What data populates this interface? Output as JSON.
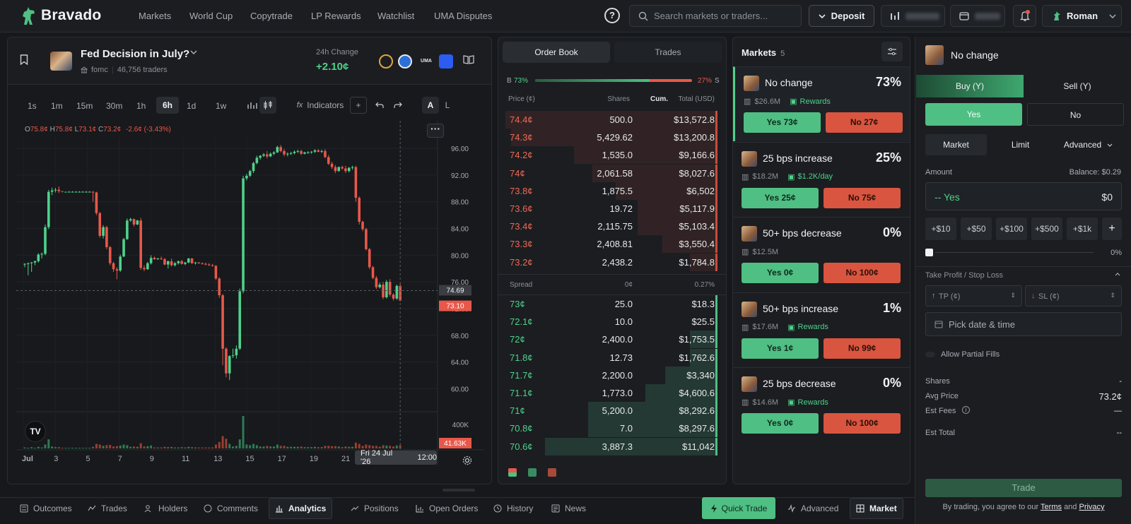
{
  "brand": {
    "name": "Bravado"
  },
  "nav": {
    "links": [
      "Markets",
      "World Cup",
      "Copytrade",
      "LP Rewards",
      "Watchlist",
      "UMA Disputes"
    ],
    "help": "?",
    "search_placeholder": "Search markets or traders...",
    "deposit": "Deposit",
    "user": "Roman"
  },
  "market": {
    "title": "Fed Decision in July?",
    "tag": "fomc",
    "traders": "46,756 traders",
    "change_label": "24h Change",
    "change_value": "+2.10¢"
  },
  "chart_toolbar": {
    "timeframes": [
      "1s",
      "1m",
      "15m",
      "30m",
      "1h",
      "6h",
      "1d",
      "1w"
    ],
    "selected": "6h",
    "indicators": "Indicators",
    "scale_a": "A",
    "scale_l": "L"
  },
  "chart_data": {
    "type": "candlestick",
    "ohlc_readout": {
      "o_label": "O",
      "o": "75.8¢",
      "h_label": "H",
      "h": "75.8¢",
      "l_label": "L",
      "l": "73.1¢",
      "c_label": "C",
      "c": "73.2¢",
      "chg": "-2.6¢ (-3.43%)"
    },
    "y_ticks": [
      "96.00",
      "92.00",
      "88.00",
      "84.00",
      "80.00",
      "76.00",
      "72.00",
      "68.00",
      "64.00",
      "60.00"
    ],
    "ylim": [
      57.4,
      97.6
    ],
    "volume_tick": "400K",
    "x_ticks": [
      "Jul",
      "3",
      "5",
      "7",
      "9",
      "11",
      "13",
      "15",
      "17",
      "19",
      "21"
    ],
    "crosshair_price": "74.69",
    "last_price": "73.10",
    "last_volume": "41.63K",
    "crosshair_date": "Fri 24 Jul '26",
    "crosshair_time": "12:00",
    "tv_logo": "TV",
    "candles": [
      [
        78.6,
        78.8,
        78.2,
        78.7
      ],
      [
        78.7,
        78.9,
        77.0,
        78.8
      ],
      [
        78.8,
        79.0,
        77.5,
        78.9
      ],
      [
        78.9,
        79.2,
        78.5,
        79.1
      ],
      [
        79.1,
        80.3,
        78.9,
        80.1
      ],
      [
        80.1,
        80.4,
        79.5,
        80.2
      ],
      [
        80.2,
        84.6,
        80.0,
        84.2
      ],
      [
        84.2,
        89.8,
        83.9,
        89.5
      ],
      [
        89.5,
        90.1,
        89.0,
        89.7
      ],
      [
        89.7,
        90.1,
        89.4,
        89.8
      ],
      [
        89.8,
        90.3,
        89.3,
        89.6
      ],
      [
        89.6,
        89.6,
        89.4,
        89.5
      ],
      [
        89.5,
        89.5,
        89.4,
        89.5
      ],
      [
        89.5,
        89.6,
        89.4,
        89.5
      ],
      [
        89.5,
        89.6,
        89.4,
        89.5
      ],
      [
        89.5,
        89.6,
        89.4,
        89.5
      ],
      [
        89.5,
        89.6,
        89.4,
        89.5
      ],
      [
        89.5,
        89.6,
        89.4,
        89.5
      ],
      [
        89.5,
        89.6,
        89.4,
        89.5
      ],
      [
        89.5,
        89.6,
        89.4,
        89.5
      ],
      [
        89.5,
        89.6,
        88.0,
        89.4
      ],
      [
        89.4,
        89.5,
        86.0,
        86.3
      ],
      [
        86.3,
        86.5,
        82.6,
        82.9
      ],
      [
        82.9,
        84.5,
        82.5,
        84.2
      ],
      [
        84.2,
        84.4,
        80.9,
        81.2
      ],
      [
        81.2,
        81.4,
        78.5,
        78.8
      ],
      [
        78.8,
        79.0,
        77.5,
        77.9
      ],
      [
        77.9,
        78.2,
        76.4,
        77.7
      ],
      [
        77.7,
        80.1,
        77.5,
        79.8
      ],
      [
        79.8,
        82.6,
        79.7,
        82.4
      ],
      [
        82.4,
        85.5,
        82.3,
        85.2
      ],
      [
        85.2,
        85.6,
        85.0,
        85.4
      ],
      [
        85.4,
        85.5,
        84.3,
        84.6
      ],
      [
        84.6,
        85.3,
        84.5,
        85.2
      ],
      [
        85.2,
        85.6,
        77.8,
        78.1
      ],
      [
        78.1,
        78.5,
        77.6,
        77.9
      ],
      [
        77.9,
        79.0,
        77.8,
        78.8
      ],
      [
        78.8,
        80.0,
        78.6,
        79.6
      ],
      [
        79.6,
        79.8,
        79.3,
        79.4
      ],
      [
        79.4,
        79.6,
        79.3,
        79.5
      ],
      [
        79.5,
        79.8,
        79.3,
        79.4
      ],
      [
        79.4,
        79.6,
        78.5,
        78.6
      ],
      [
        78.6,
        79.2,
        78.0,
        79.1
      ],
      [
        79.1,
        79.5,
        78.3,
        78.5
      ],
      [
        78.5,
        79.0,
        78.3,
        78.8
      ],
      [
        78.8,
        79.2,
        78.6,
        79.1
      ],
      [
        79.1,
        79.3,
        78.6,
        78.7
      ],
      [
        78.7,
        79.0,
        78.5,
        78.9
      ],
      [
        78.9,
        79.6,
        78.8,
        79.5
      ],
      [
        79.5,
        79.6,
        78.7,
        78.8
      ],
      [
        78.8,
        79.0,
        78.6,
        78.9
      ],
      [
        78.9,
        79.0,
        78.7,
        78.8
      ],
      [
        78.8,
        78.9,
        78.6,
        78.7
      ],
      [
        78.7,
        78.9,
        78.5,
        78.6
      ],
      [
        78.6,
        78.8,
        78.4,
        78.5
      ],
      [
        78.5,
        78.7,
        78.3,
        78.4
      ],
      [
        78.4,
        78.5,
        76.3,
        76.5
      ],
      [
        76.5,
        76.7,
        73.6,
        74.0
      ],
      [
        74.0,
        74.2,
        63.5,
        66.0
      ],
      [
        66.0,
        66.2,
        61.7,
        62.3
      ],
      [
        62.3,
        65.0,
        61.3,
        64.9
      ],
      [
        64.9,
        66.0,
        64.6,
        65.0
      ],
      [
        65.0,
        66.5,
        64.5,
        66.0
      ],
      [
        66.0,
        75.0,
        65.8,
        74.6
      ],
      [
        74.6,
        91.9,
        74.3,
        91.5
      ],
      [
        91.5,
        92.2,
        91.2,
        91.9
      ],
      [
        91.9,
        92.8,
        91.7,
        92.6
      ],
      [
        92.6,
        94.0,
        92.3,
        93.8
      ],
      [
        93.8,
        94.9,
        93.6,
        94.6
      ],
      [
        94.6,
        95.0,
        94.3,
        94.9
      ],
      [
        94.9,
        95.3,
        94.7,
        95.1
      ],
      [
        95.1,
        95.6,
        94.5,
        94.8
      ],
      [
        94.8,
        95.4,
        94.7,
        95.2
      ],
      [
        95.2,
        95.6,
        95.0,
        95.4
      ],
      [
        95.4,
        96.4,
        95.3,
        96.2
      ],
      [
        96.2,
        96.5,
        95.4,
        95.6
      ],
      [
        95.6,
        95.9,
        94.8,
        95.1
      ],
      [
        95.1,
        95.4,
        94.8,
        95.2
      ],
      [
        95.2,
        95.5,
        95.0,
        95.3
      ],
      [
        95.3,
        95.7,
        95.1,
        95.5
      ],
      [
        95.5,
        95.8,
        95.3,
        95.6
      ],
      [
        95.6,
        95.8,
        95.0,
        95.2
      ],
      [
        95.2,
        95.5,
        95.1,
        95.4
      ],
      [
        95.4,
        95.6,
        95.2,
        95.4
      ],
      [
        95.4,
        95.6,
        95.2,
        95.5
      ],
      [
        95.5,
        95.9,
        95.3,
        95.7
      ],
      [
        95.7,
        95.9,
        95.4,
        95.5
      ],
      [
        95.5,
        95.8,
        95.3,
        95.6
      ],
      [
        95.6,
        95.9,
        94.5,
        94.7
      ],
      [
        94.7,
        95.0,
        93.5,
        93.7
      ],
      [
        93.7,
        94.0,
        92.9,
        93.2
      ],
      [
        93.2,
        93.5,
        92.3,
        92.6
      ],
      [
        92.6,
        93.3,
        92.5,
        93.2
      ],
      [
        93.2,
        93.4,
        92.8,
        93.0
      ],
      [
        93.0,
        93.4,
        92.3,
        92.6
      ],
      [
        92.6,
        93.2,
        92.4,
        93.1
      ],
      [
        93.1,
        93.4,
        92.8,
        93.2
      ],
      [
        93.2,
        93.4,
        88.0,
        88.6
      ],
      [
        88.6,
        88.8,
        84.6,
        85.0
      ],
      [
        85.0,
        85.2,
        83.6,
        83.9
      ],
      [
        83.9,
        84.1,
        80.7,
        80.9
      ],
      [
        80.9,
        81.1,
        77.9,
        78.2
      ],
      [
        78.2,
        78.4,
        76.4,
        76.6
      ],
      [
        76.6,
        76.9,
        74.9,
        75.2
      ],
      [
        75.2,
        75.9,
        75.0,
        75.6
      ],
      [
        75.6,
        76.0,
        73.4,
        73.7
      ],
      [
        73.7,
        76.3,
        73.5,
        76.0
      ],
      [
        76.0,
        76.4,
        73.8,
        74.1
      ],
      [
        74.1,
        74.3,
        73.2,
        73.5
      ],
      [
        73.5,
        75.6,
        73.3,
        75.4
      ],
      [
        75.4,
        75.8,
        73.1,
        73.2
      ]
    ],
    "volumes": [
      3,
      2,
      4,
      2,
      5,
      3,
      12,
      28,
      6,
      4,
      4,
      2,
      2,
      2,
      2,
      2,
      2,
      2,
      2,
      2,
      5,
      14,
      12,
      8,
      10,
      11,
      6,
      7,
      9,
      12,
      10,
      5,
      6,
      5,
      16,
      6,
      7,
      9,
      3,
      3,
      3,
      5,
      4,
      5,
      3,
      3,
      4,
      3,
      5,
      4,
      3,
      3,
      3,
      3,
      3,
      3,
      12,
      20,
      38,
      30,
      14,
      6,
      8,
      28,
      100,
      12,
      10,
      14,
      10,
      6,
      6,
      8,
      6,
      6,
      12,
      8,
      8,
      5,
      5,
      5,
      5,
      6,
      4,
      4,
      4,
      5,
      4,
      4,
      8,
      8,
      7,
      7,
      6,
      4,
      6,
      5,
      5,
      18,
      14,
      8,
      12,
      10,
      8,
      8,
      5,
      10,
      9,
      8,
      6,
      9,
      10
    ]
  },
  "orderbook": {
    "tabs": [
      "Order Book",
      "Trades"
    ],
    "active_tab": "Order Book",
    "b_label": "B",
    "b_pct": "73%",
    "s_pct": "27%",
    "s_label": "S",
    "col_price": "Price (¢)",
    "col_shares": "Shares",
    "col_cum": "Cum.",
    "col_total": "Total (USD)",
    "asks": [
      {
        "price": "74.4¢",
        "shares": "500.0",
        "total": "$13,572.8",
        "depth": 0.0
      },
      {
        "price": "74.3¢",
        "shares": "5,429.62",
        "total": "$13,200.8",
        "depth": 0.0
      },
      {
        "price": "74.2¢",
        "shares": "1,535.0",
        "total": "$9,166.6",
        "depth": 0.0
      },
      {
        "price": "74¢",
        "shares": "2,061.58",
        "total": "$8,027.6",
        "depth": 0.0
      },
      {
        "price": "73.8¢",
        "shares": "1,875.5",
        "total": "$6,502",
        "depth": 0.0
      },
      {
        "price": "73.6¢",
        "shares": "19.72",
        "total": "$5,117.9",
        "depth": 0.0
      },
      {
        "price": "73.4¢",
        "shares": "2,115.75",
        "total": "$5,103.4",
        "depth": 0.0
      },
      {
        "price": "73.3¢",
        "shares": "2,408.81",
        "total": "$3,550.4",
        "depth": 0.0
      },
      {
        "price": "73.2¢",
        "shares": "2,438.2",
        "total": "$1,784.8",
        "depth": 0.0
      }
    ],
    "spread_label": "Spread",
    "spread_value": "0¢",
    "spread_pct": "0.27%",
    "bids": [
      {
        "price": "73¢",
        "shares": "25.0",
        "total": "$18.3",
        "depth": 0.0
      },
      {
        "price": "72.1¢",
        "shares": "10.0",
        "total": "$25.5",
        "depth": 0.0
      },
      {
        "price": "72¢",
        "shares": "2,400.0",
        "total": "$1,753.5",
        "depth": 0.0
      },
      {
        "price": "71.8¢",
        "shares": "12.73",
        "total": "$1,762.6",
        "depth": 0.0
      },
      {
        "price": "71.7¢",
        "shares": "2,200.0",
        "total": "$3,340",
        "depth": 0.0
      },
      {
        "price": "71.1¢",
        "shares": "1,773.0",
        "total": "$4,600.6",
        "depth": 0.0
      },
      {
        "price": "71¢",
        "shares": "5,200.0",
        "total": "$8,292.6",
        "depth": 0.0
      },
      {
        "price": "70.8¢",
        "shares": "7.0",
        "total": "$8,297.6",
        "depth": 0.0
      },
      {
        "price": "70.6¢",
        "shares": "3,887.3",
        "total": "$11,042",
        "depth": 0.0
      }
    ]
  },
  "markets_list": {
    "title": "Markets",
    "count": "5",
    "items": [
      {
        "name": "No change",
        "pct": "73%",
        "vol": "$26.6M",
        "reward": "Rewards",
        "yes": "Yes 73¢",
        "no": "No 27¢"
      },
      {
        "name": "25 bps increase",
        "pct": "25%",
        "vol": "$18.2M",
        "reward": "$1.2K/day",
        "yes": "Yes 25¢",
        "no": "No 75¢"
      },
      {
        "name": "50+ bps decrease",
        "pct": "0%",
        "vol": "$12.5M",
        "reward": "",
        "yes": "Yes 0¢",
        "no": "No 100¢"
      },
      {
        "name": "50+ bps increase",
        "pct": "1%",
        "vol": "$17.6M",
        "reward": "Rewards",
        "yes": "Yes 1¢",
        "no": "No 99¢"
      },
      {
        "name": "25 bps decrease",
        "pct": "0%",
        "vol": "$14.6M",
        "reward": "Rewards",
        "yes": "Yes 0¢",
        "no": "No 100¢"
      }
    ]
  },
  "trade": {
    "selected_market": "No change",
    "buy_tab": "Buy (Y)",
    "sell_tab": "Sell (Y)",
    "yes": "Yes",
    "no": "No",
    "order_types": [
      "Market",
      "Limit",
      "Advanced"
    ],
    "amount_label": "Amount",
    "balance_label": "Balance: $0.29",
    "amount_outcome": "-- Yes",
    "amount_value": "$0",
    "quick_amounts": [
      "+$10",
      "+$50",
      "+$100",
      "+$500",
      "+$1k"
    ],
    "plus": "+",
    "slider_pct": "0%",
    "tpsl_label": "Take Profit / Stop Loss",
    "tp": "TP (¢)",
    "sl": "SL (¢)",
    "date_placeholder": "Pick date & time",
    "partial_fills": "Allow Partial Fills",
    "shares_label": "Shares",
    "shares_value": "-",
    "avg_label": "Avg Price",
    "avg_value": "73.2¢",
    "fees_label": "Est Fees",
    "fees_value": "—",
    "total_label": "Est Total",
    "total_value": "--",
    "trade_btn": "Trade",
    "legal_prefix": "By trading, you agree to our",
    "terms": "Terms",
    "and": "and",
    "privacy": "Privacy"
  },
  "bottom": {
    "tabs": [
      "Outcomes",
      "Trades",
      "Holders",
      "Comments",
      "Analytics",
      "Positions",
      "Open Orders",
      "History",
      "News"
    ],
    "active": "Analytics",
    "quick_trade": "Quick Trade",
    "advanced": "Advanced",
    "market": "Market"
  },
  "colors": {
    "green": "#4fd18b",
    "red": "#e8584a",
    "bg": "#16181b"
  }
}
